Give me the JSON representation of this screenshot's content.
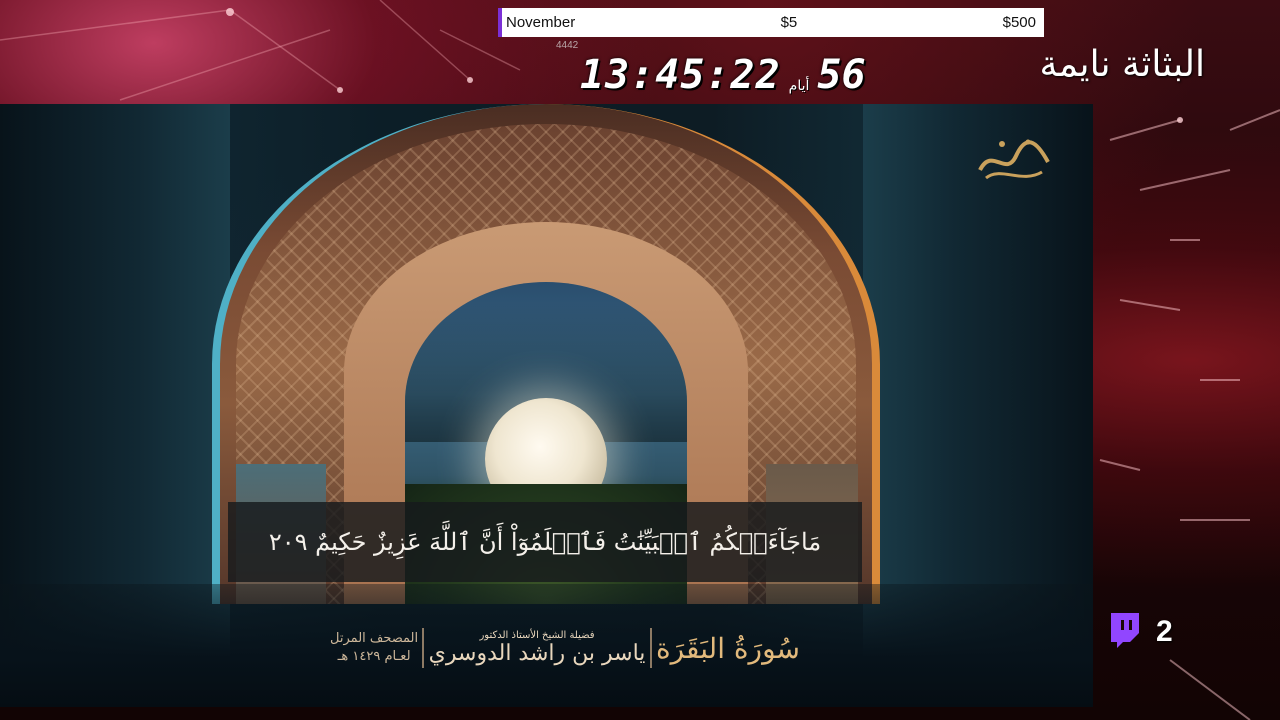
{
  "goal": {
    "month": "November",
    "current": "$5",
    "target": "$500",
    "accent": "#7b2fd6"
  },
  "mini_code": "4442",
  "countdown": {
    "days": "56",
    "days_label": "أيام",
    "time": "13:45:22"
  },
  "status_text": "البثاثة نايمة",
  "video": {
    "verse": "مَاجَآءَتۡكُمُ ٱلۡبَيِّنَٰتُ فَٱعۡلَمُوٓاْ أَنَّ ٱللَّهَ عَزِيزٌ حَكِيمٌ ٢٠٩",
    "surah": "سُورَةُ البَقَرَة",
    "reciter_title": "فضيلة الشيخ الأستاذ الدكتور",
    "reciter_name": "ياسر بن راشد الدوسري",
    "mushaf_label": "المصحف المرتل",
    "mushaf_year": "لعـام ١٤٢٩ هـ",
    "logo_icon": "calligraphy-logo"
  },
  "viewers": {
    "icon": "twitch-icon",
    "count": "2",
    "color": "#9146ff"
  }
}
